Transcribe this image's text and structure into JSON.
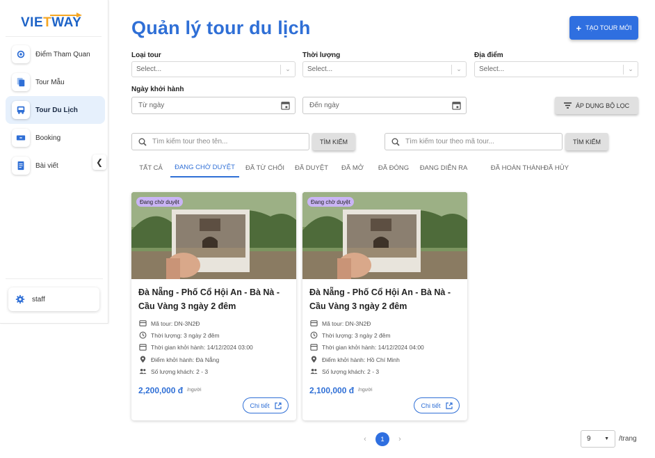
{
  "brand": {
    "logo_text_1": "VIE",
    "logo_text_2": "T",
    "logo_text_3": "WAY"
  },
  "sidebar": {
    "items": [
      {
        "label": "Điểm Tham Quan",
        "icon": "attraction-icon",
        "active": false
      },
      {
        "label": "Tour Mẫu",
        "icon": "document-copy-icon",
        "active": false
      },
      {
        "label": "Tour Du Lịch",
        "icon": "bus-icon",
        "active": true
      },
      {
        "label": "Booking",
        "icon": "ticket-icon",
        "active": false
      },
      {
        "label": "Bài viết",
        "icon": "article-icon",
        "active": false
      }
    ],
    "collapse_icon": "chevron-left-icon",
    "user": {
      "name": "staff",
      "icon": "gear-icon"
    }
  },
  "header": {
    "title": "Quản lý tour du lịch",
    "create_button": {
      "icon": "+",
      "label": "TẠO TOUR MỚI"
    }
  },
  "filters": {
    "tour_type": {
      "label": "Loại tour",
      "placeholder": "Select..."
    },
    "duration": {
      "label": "Thời lượng",
      "placeholder": "Select..."
    },
    "location": {
      "label": "Địa điểm",
      "placeholder": "Select..."
    },
    "departure": {
      "label": "Ngày khởi hành",
      "from_placeholder": "Từ ngày",
      "to_placeholder": "Đến ngày"
    },
    "apply_button": "ÁP DỤNG BỘ LỌC"
  },
  "search": {
    "by_name": {
      "placeholder": "Tìm kiếm tour theo tên...",
      "button": "TÌM KIẾM"
    },
    "by_code": {
      "placeholder": "Tìm kiếm tour theo mã tour...",
      "button": "TÌM KIẾM"
    }
  },
  "tabs": [
    {
      "label": "TẤT CẢ",
      "active": false
    },
    {
      "label": "ĐANG CHỜ DUYỆT",
      "active": true
    },
    {
      "label": "ĐÃ TỪ CHỐI",
      "active": false
    },
    {
      "label": "ĐÃ DUYỆT",
      "active": false
    },
    {
      "label": "ĐÃ MỞ",
      "active": false
    },
    {
      "label": "ĐÃ ĐÓNG",
      "active": false
    },
    {
      "label": "ĐANG DIỄN RA",
      "active": false
    },
    {
      "label": "ĐÃ HOÀN THÀNH",
      "active": false
    },
    {
      "label": "ĐÃ HỦY",
      "active": false
    }
  ],
  "tours": [
    {
      "badge": "Đang chờ duyệt",
      "title": "Đà Nẵng - Phố Cổ Hội An - Bà Nà - Cầu Vàng 3 ngày 2 đêm",
      "code": "Mã tour: DN-3N2Đ",
      "duration": "Thời lượng: 3 ngày 2 đêm",
      "departure_time": "Thời gian khởi hành: 14/12/2024 03:00",
      "departure_place": "Điểm khởi hành: Đà Nẵng",
      "guests": "Số lượng khách: 2 - 3",
      "price": "2,200,000 đ",
      "unit": "/người",
      "detail_button": "Chi tiết"
    },
    {
      "badge": "Đang chờ duyệt",
      "title": "Đà Nẵng - Phố Cổ Hội An - Bà Nà - Cầu Vàng 3 ngày 2 đêm",
      "code": "Mã tour: DN-3N2Đ",
      "duration": "Thời lượng: 3 ngày 2 đêm",
      "departure_time": "Thời gian khởi hành: 14/12/2024 04:00",
      "departure_place": "Điểm khởi hành: Hồ Chí Minh",
      "guests": "Số lượng khách: 2 - 3",
      "price": "2,100,000 đ",
      "unit": "/người",
      "detail_button": "Chi tiết"
    }
  ],
  "pagination": {
    "current_page": "1",
    "per_page": "9",
    "per_page_label": "/trang"
  },
  "colors": {
    "primary": "#2f6fd6",
    "badge": "#c9b4f5",
    "active_nav": "#e6f0fc"
  }
}
